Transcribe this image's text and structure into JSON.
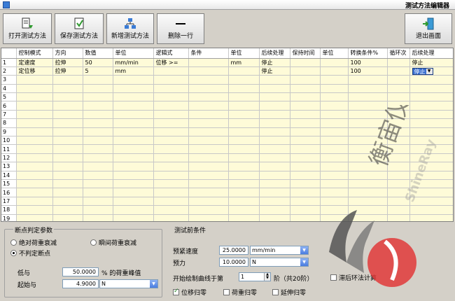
{
  "window": {
    "title": "测试方法编辑器"
  },
  "toolbar": {
    "open_label": "打开测试方法",
    "save_label": "保存测试方法",
    "new_label": "新增测试方法",
    "delete_label": "删除一行",
    "exit_label": "退出画面"
  },
  "grid": {
    "headers": [
      "控制模式",
      "方向",
      "数值",
      "单位",
      "逻辑式",
      "条件",
      "单位",
      "后续处理",
      "保持时间",
      "单位",
      "转换条件%",
      "循环次",
      "后续处理"
    ],
    "rows": [
      [
        "定速度",
        "拉伸",
        "50",
        "mm/min",
        "位移 >=",
        "",
        "mm",
        "停止",
        "",
        "",
        "100",
        "",
        "停止"
      ],
      [
        "定位移",
        "拉伸",
        "5",
        "mm",
        "",
        "",
        "",
        "停止",
        "",
        "",
        "100",
        "",
        "停止"
      ]
    ],
    "row_numbers": [
      "1",
      "2",
      "3",
      "4",
      "5",
      "6",
      "7",
      "8",
      "9",
      "10",
      "11",
      "12",
      "13",
      "14",
      "15",
      "16",
      "17",
      "18",
      "19"
    ]
  },
  "breakpoint": {
    "title": "断点判定参数",
    "opt_absolute": "绝对荷重衰减",
    "opt_instant": "瞬间荷重衰减",
    "opt_none": "不判定断点",
    "selected": "opt_none",
    "below_label": "低与",
    "below_value": "50.0000",
    "below_suffix": "% 的荷重峰值",
    "start_label": "起始与",
    "start_value": "4.9000",
    "start_unit": "N"
  },
  "pretest": {
    "title": "测试前条件",
    "preload_speed_label": "预紧速度",
    "preload_speed_value": "25.0000",
    "preload_speed_unit": "mm/min",
    "preload_force_label": "预力",
    "preload_force_value": "10.0000",
    "preload_force_unit": "N",
    "curve_start_label": "开始绘制曲线于第",
    "curve_start_value": "1",
    "curve_start_suffix": "阶（共20阶）",
    "chk_disp_zero": "位移归零",
    "chk_load_zero": "荷重归零",
    "chk_ext_zero": "延伸归零",
    "disp_zero_checked": true,
    "load_zero_checked": false,
    "ext_zero_checked": false
  },
  "loop_calc": {
    "label": "滞后环法计算",
    "checked": false
  },
  "watermark": {
    "text_cn": "衡宙仪器",
    "text_en": "ShineRay"
  },
  "colors": {
    "grid_row_bg": "#fefbd8",
    "selection": "#3a6fd0",
    "logo_red": "#e03a3a"
  }
}
